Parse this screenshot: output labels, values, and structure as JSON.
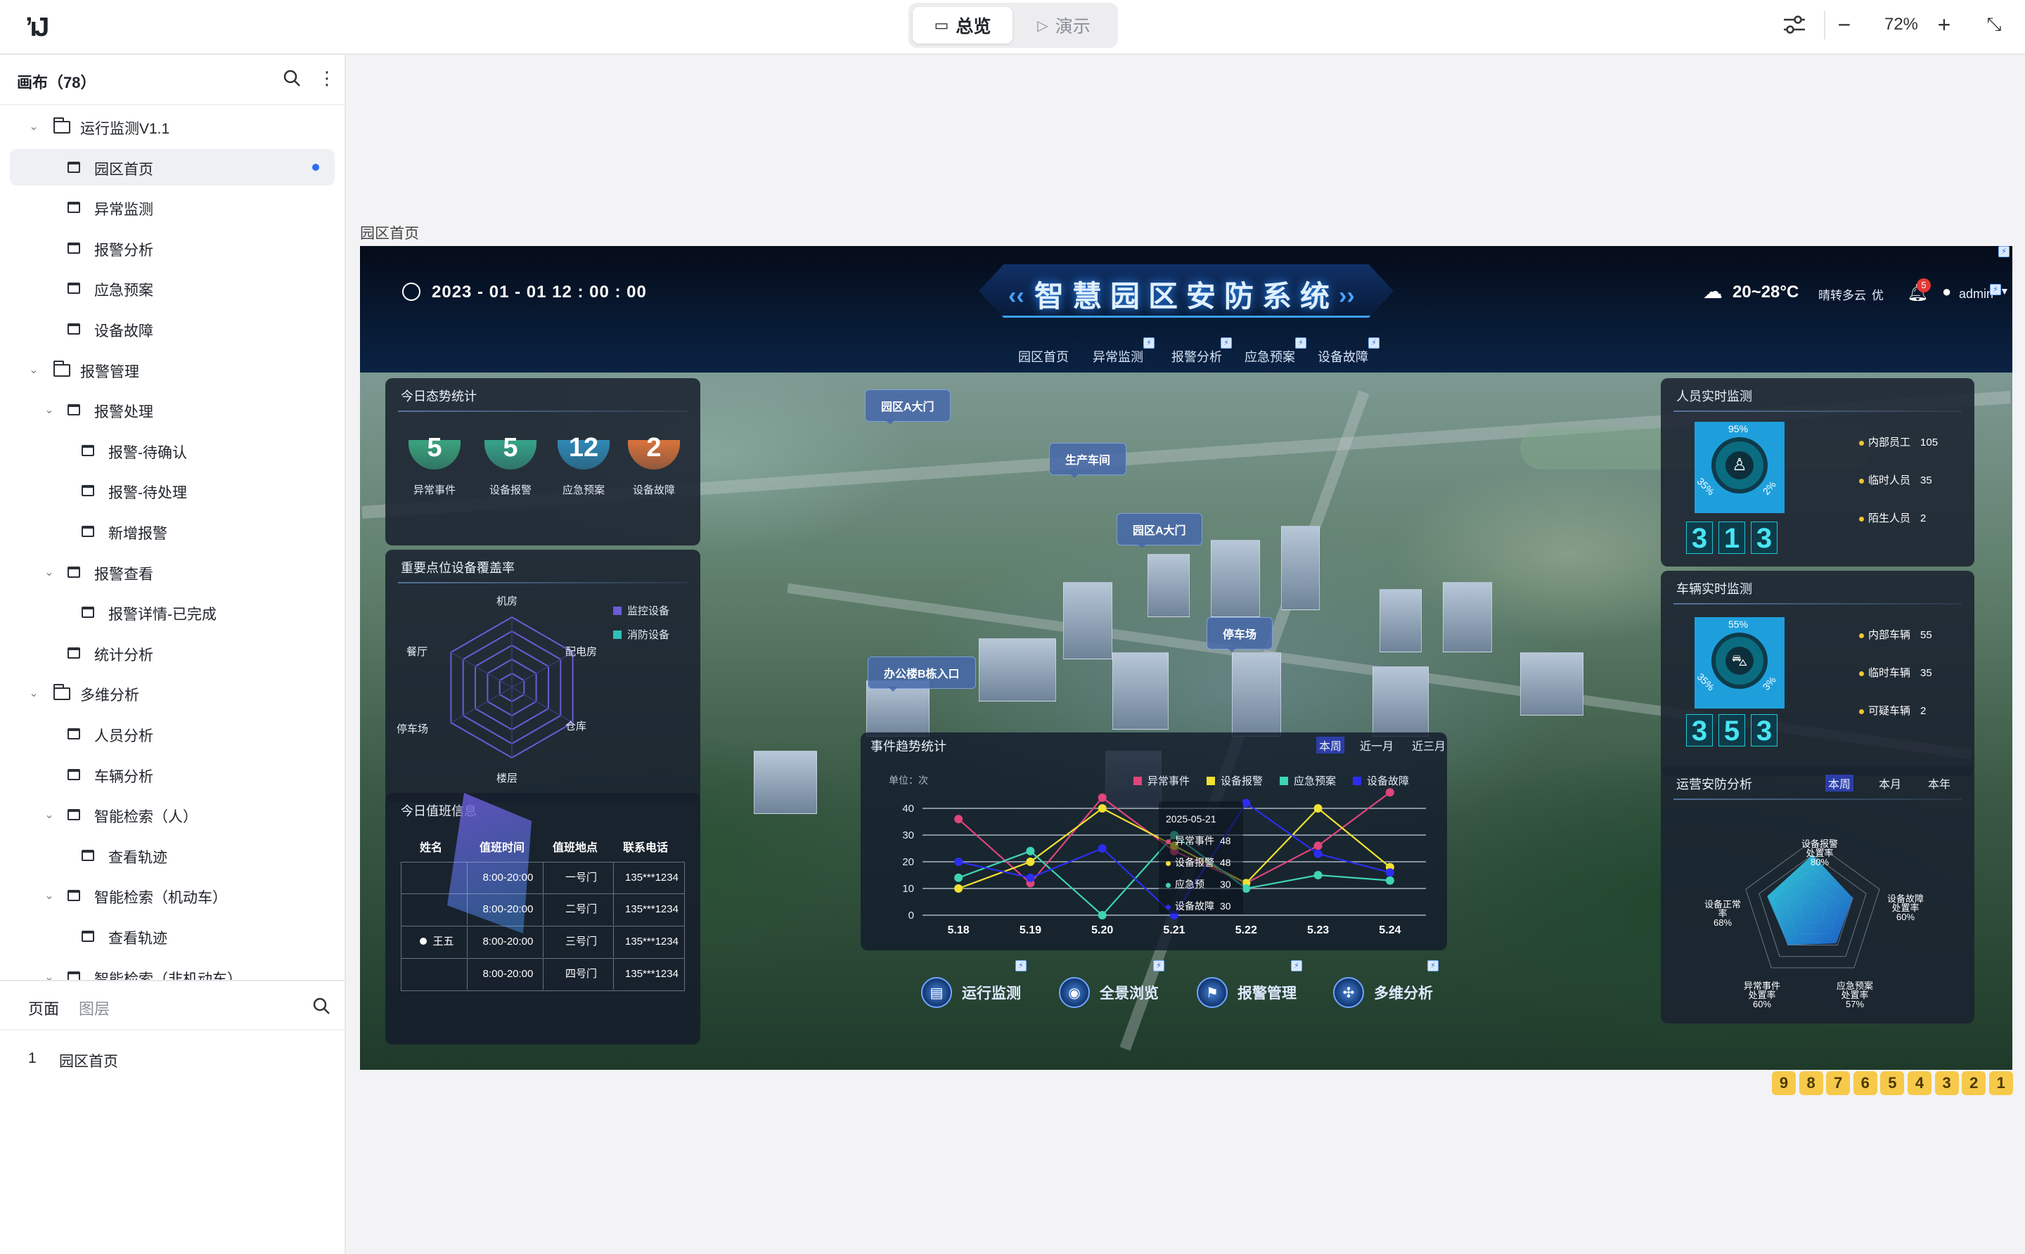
{
  "app": {
    "logo": "’ıJ"
  },
  "modes": {
    "overview": "总览",
    "present": "演示"
  },
  "zoom": {
    "value": "72%"
  },
  "sidebar": {
    "title": "画布（78）",
    "tree": [
      {
        "label": "运行监测V1.1",
        "type": "folder",
        "level": 0
      },
      {
        "label": "园区首页",
        "type": "page",
        "level": 1,
        "selected": true
      },
      {
        "label": "异常监测",
        "type": "page",
        "level": 1
      },
      {
        "label": "报警分析",
        "type": "page",
        "level": 1
      },
      {
        "label": "应急预案",
        "type": "page",
        "level": 1
      },
      {
        "label": "设备故障",
        "type": "page",
        "level": 1
      },
      {
        "label": "报警管理",
        "type": "folder",
        "level": 0
      },
      {
        "label": "报警处理",
        "type": "group",
        "level": 1
      },
      {
        "label": "报警-待确认",
        "type": "page",
        "level": 2
      },
      {
        "label": "报警-待处理",
        "type": "page",
        "level": 2
      },
      {
        "label": "新增报警",
        "type": "page",
        "level": 2
      },
      {
        "label": "报警查看",
        "type": "group",
        "level": 1
      },
      {
        "label": "报警详情-已完成",
        "type": "page",
        "level": 2
      },
      {
        "label": "统计分析",
        "type": "page",
        "level": 1
      },
      {
        "label": "多维分析",
        "type": "folder",
        "level": 0
      },
      {
        "label": "人员分析",
        "type": "page",
        "level": 1
      },
      {
        "label": "车辆分析",
        "type": "page",
        "level": 1
      },
      {
        "label": "智能检索（人）",
        "type": "group",
        "level": 1
      },
      {
        "label": "查看轨迹",
        "type": "page",
        "level": 2
      },
      {
        "label": "智能检索（机动车）",
        "type": "group",
        "level": 1
      },
      {
        "label": "查看轨迹",
        "type": "page",
        "level": 2
      },
      {
        "label": "智能检索（非机动车）",
        "type": "group",
        "level": 1
      }
    ],
    "tabs": {
      "pages": "页面",
      "layers": "图层"
    },
    "pages": [
      {
        "index": "1",
        "label": "园区首页"
      }
    ]
  },
  "canvas": {
    "frame_label": "园区首页"
  },
  "dashboard": {
    "datetime": "2023 - 01 - 01    12 : 00 : 00",
    "title": "智慧园区安防系统",
    "weather": {
      "temp": "20~28°C",
      "desc": "晴转多云",
      "aqi": "优"
    },
    "notify_count": "5",
    "user": "admin",
    "nav": [
      "园区首页",
      "异常监测",
      "报警分析",
      "应急预案",
      "设备故障"
    ],
    "today_stats": {
      "title": "今日态势统计",
      "items": [
        {
          "value": "5",
          "label": "异常事件",
          "color": "#3aa47e"
        },
        {
          "value": "5",
          "label": "设备报警",
          "color": "#36a38a"
        },
        {
          "value": "12",
          "label": "应急预案",
          "color": "#2f8ab8"
        },
        {
          "value": "2",
          "label": "设备故障",
          "color": "#d9733c"
        }
      ]
    },
    "coverage": {
      "title": "重要点位设备覆盖率",
      "axes": [
        "机房",
        "配电房",
        "仓库",
        "楼层",
        "停车场",
        "餐厅"
      ],
      "legend": [
        {
          "name": "监控设备",
          "color": "#6b5bd6"
        },
        {
          "name": "消防设备",
          "color": "#2ec1b8"
        }
      ]
    },
    "duty": {
      "title": "今日值班信息",
      "headers": [
        "姓名",
        "值班时间",
        "值班地点",
        "联系电话"
      ],
      "rows": [
        [
          "",
          "8:00-20:00",
          "一号门",
          "135***1234"
        ],
        [
          "",
          "8:00-20:00",
          "二号门",
          "135***1234"
        ],
        [
          "王五",
          "8:00-20:00",
          "三号门",
          "135***1234"
        ],
        [
          "",
          "8:00-20:00",
          "四号门",
          "135***1234"
        ]
      ]
    },
    "map_labels": [
      "园区A大门",
      "生产车间",
      "园区A大门",
      "停车场",
      "办公楼B栋入口"
    ],
    "trend": {
      "title": "事件趋势统计",
      "unit": "单位：次",
      "periods": [
        "本周",
        "近一月",
        "近三月"
      ],
      "tooltip": {
        "date": "2025-05-21",
        "rows": [
          {
            "name": "异常事件",
            "value": "48",
            "color": "#e0457b"
          },
          {
            "name": "设备报警",
            "value": "48",
            "color": "#f2e231"
          },
          {
            "name": "应急预",
            "value": "30",
            "color": "#3fd4b4"
          },
          {
            "name": "设备故障",
            "value": "30",
            "color": "#2b2ef0"
          }
        ]
      }
    },
    "personnel": {
      "title": "人员实时监测",
      "ring_top": "95%",
      "ring_left": "35%",
      "ring_right": "2%",
      "digits": [
        "3",
        "1",
        "3"
      ],
      "items": [
        {
          "label": "内部员工",
          "value": "105"
        },
        {
          "label": "临时人员",
          "value": "35"
        },
        {
          "label": "陌生人员",
          "value": "2"
        }
      ]
    },
    "vehicle": {
      "title": "车辆实时监测",
      "ring_top": "55%",
      "ring_left": "35%",
      "ring_right": "3%",
      "digits": [
        "3",
        "5",
        "3"
      ],
      "items": [
        {
          "label": "内部车辆",
          "value": "55"
        },
        {
          "label": "临时车辆",
          "value": "35"
        },
        {
          "label": "可疑车辆",
          "value": "2"
        }
      ]
    },
    "safety": {
      "title": "运营安防分析",
      "periods": [
        "本周",
        "本月",
        "本年"
      ],
      "axes": [
        {
          "name": "设备报警",
          "sub": "处置率",
          "value": "80%"
        },
        {
          "name": "设备故障",
          "sub": "处置率",
          "value": "60%"
        },
        {
          "name": "应急预案",
          "sub": "处置率",
          "value": "57%"
        },
        {
          "name": "异常事件",
          "sub": "处置率",
          "value": "60%"
        },
        {
          "name": "设备正常",
          "sub": "率",
          "value": "68%"
        }
      ]
    },
    "bottom_nav": [
      "运行监测",
      "全景浏览",
      "报警管理",
      "多维分析"
    ]
  },
  "chart_data": {
    "type": "line",
    "x": [
      "5.18",
      "5.19",
      "5.20",
      "5.21",
      "5.22",
      "5.23",
      "5.24"
    ],
    "ylim": [
      0,
      40
    ],
    "yticks": [
      0,
      10,
      20,
      30,
      40
    ],
    "series": [
      {
        "name": "异常事件",
        "color": "#e0457b",
        "values": [
          36,
          12,
          44,
          24,
          12,
          26,
          46
        ]
      },
      {
        "name": "设备报警",
        "color": "#f2e231",
        "values": [
          10,
          20,
          40,
          26,
          12,
          40,
          18
        ]
      },
      {
        "name": "应急预案",
        "color": "#3fd4b4",
        "values": [
          14,
          24,
          0,
          30,
          10,
          15,
          13
        ]
      },
      {
        "name": "设备故障",
        "color": "#2b2ef0",
        "values": [
          20,
          14,
          25,
          0,
          42,
          23,
          16
        ]
      }
    ]
  },
  "pagination": [
    "9",
    "8",
    "7",
    "6",
    "5",
    "4",
    "3",
    "2",
    "1"
  ]
}
